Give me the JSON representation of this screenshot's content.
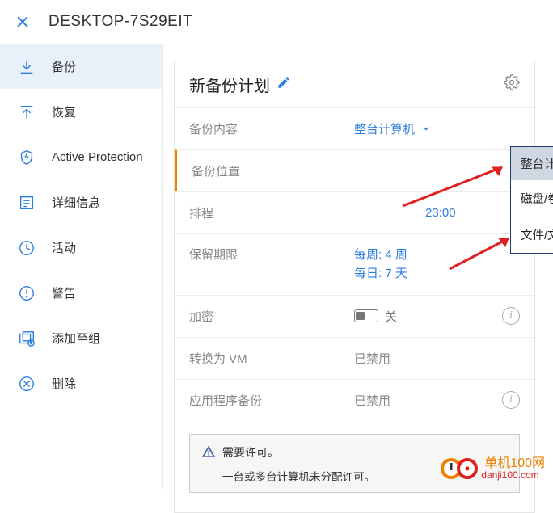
{
  "topbar": {
    "title": "DESKTOP-7S29EIT"
  },
  "sidebar": {
    "items": [
      {
        "label": "备份",
        "icon": "download"
      },
      {
        "label": "恢复",
        "icon": "upload"
      },
      {
        "label": "Active Protection",
        "icon": "shield"
      },
      {
        "label": "详细信息",
        "icon": "details"
      },
      {
        "label": "活动",
        "icon": "clock"
      },
      {
        "label": "警告",
        "icon": "alert"
      },
      {
        "label": "添加至组",
        "icon": "addgroup"
      },
      {
        "label": "删除",
        "icon": "delete"
      }
    ]
  },
  "panel": {
    "title": "新备份计划",
    "settings_icon": "gear",
    "rows": {
      "content": {
        "label": "备份内容",
        "value": "整台计算机"
      },
      "location": {
        "label": "备份位置",
        "value": ""
      },
      "schedule": {
        "label": "排程",
        "value_time": "23:00"
      },
      "retention": {
        "label": "保留期限",
        "line1": "每周: 4 周",
        "line2": "每日: 7 天"
      },
      "encryption": {
        "label": "加密",
        "switch_label": "关"
      },
      "tovm": {
        "label": "转换为 VM",
        "value": "已禁用"
      },
      "appbackup": {
        "label": "应用程序备份",
        "value": "已禁用"
      }
    },
    "dropdown": {
      "selected": "整台计算机",
      "opt1": "磁盘/卷",
      "opt2": "文件/文件夹"
    },
    "notice": {
      "title": "需要许可。",
      "sub": "一台或多台计算机未分配许可。"
    }
  },
  "watermark": {
    "name": "单机100网",
    "domain": "danji100.com"
  }
}
